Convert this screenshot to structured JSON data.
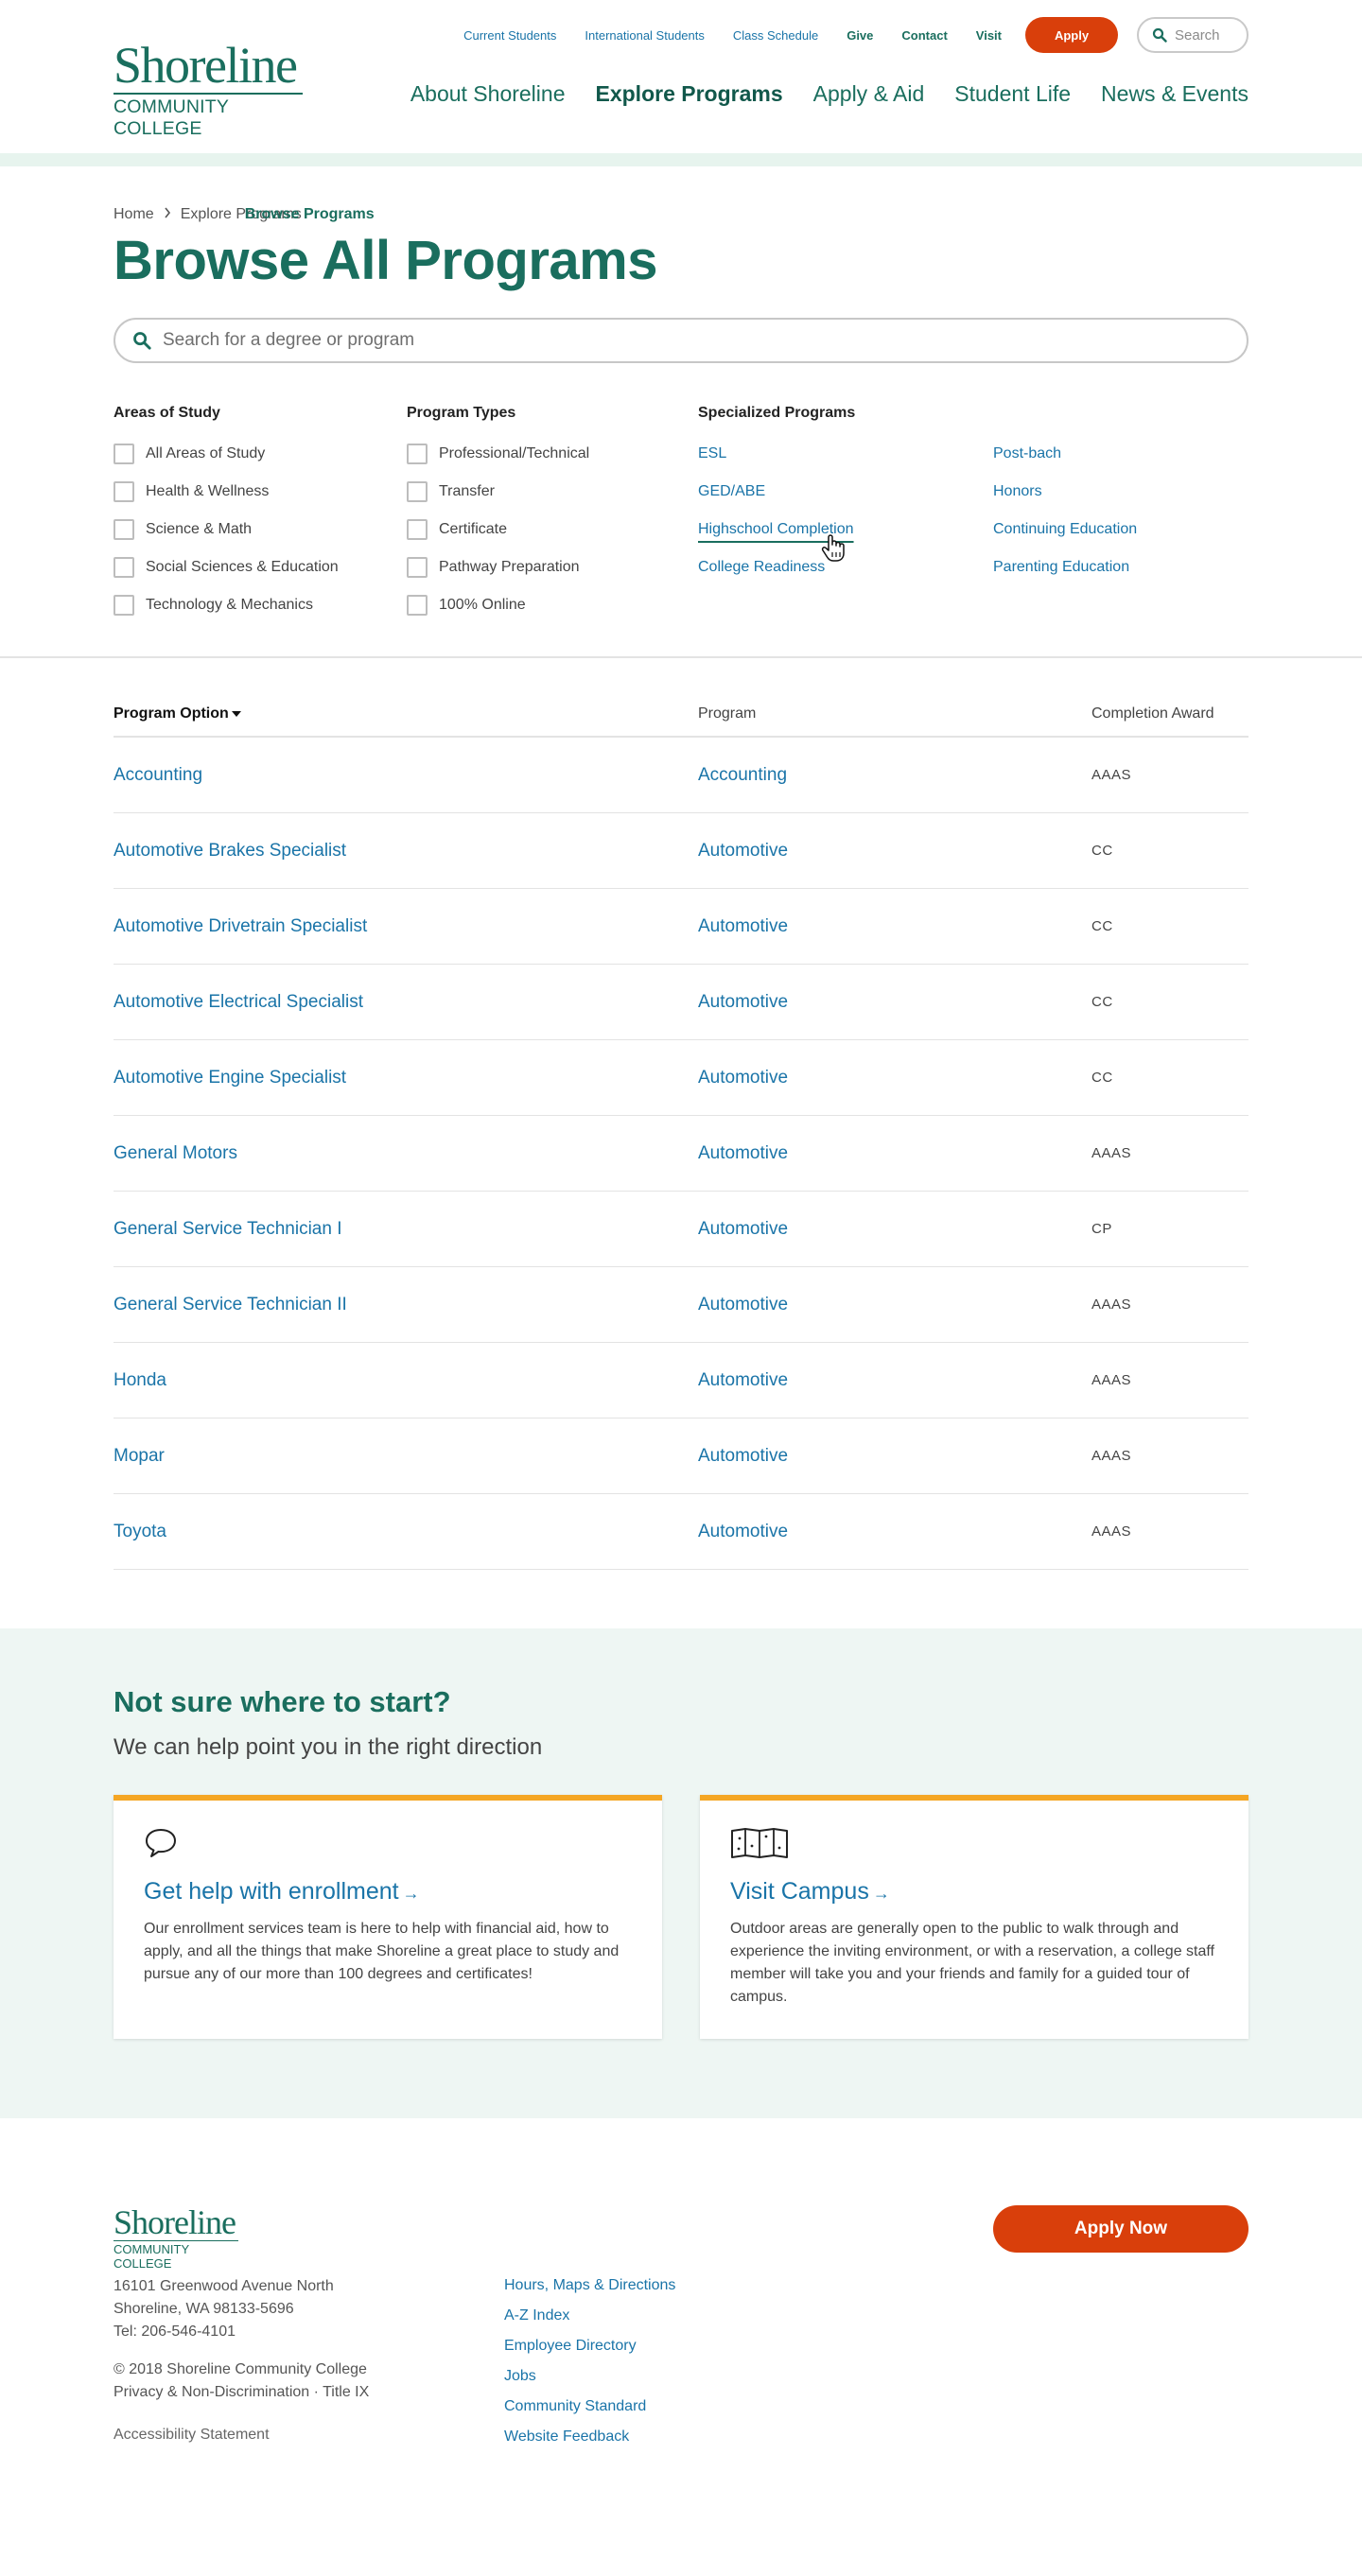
{
  "header": {
    "logo": {
      "name": "Shoreline",
      "sub": "COMMUNITY COLLEGE"
    },
    "util_links": [
      "Current Students",
      "International Students",
      "Class Schedule",
      "Give",
      "Contact",
      "Visit"
    ],
    "apply_label": "Apply",
    "search_placeholder": "Search",
    "main_nav": [
      "About Shoreline",
      "Explore Programs",
      "Apply & Aid",
      "Student Life",
      "News & Events"
    ]
  },
  "breadcrumb": {
    "home": "Home",
    "parent": "Explore Programs",
    "current": "Browse Programs"
  },
  "page_title": "Browse All Programs",
  "search": {
    "placeholder": "Search for a degree or program"
  },
  "filters": {
    "areas": {
      "heading": "Areas of Study",
      "items": [
        "All Areas of Study",
        "Health & Wellness",
        "Science & Math",
        "Social Sciences & Education",
        "Technology & Mechanics"
      ]
    },
    "types": {
      "heading": "Program Types",
      "items": [
        "Professional/Technical",
        "Transfer",
        "Certificate",
        "Pathway Preparation",
        "100% Online"
      ]
    },
    "specialized": {
      "heading": "Specialized Programs",
      "col1": [
        "ESL",
        "GED/ABE",
        "Highschool Completion",
        "College Readiness"
      ],
      "col2": [
        "Post-bach",
        "Honors",
        "Continuing Education",
        "Parenting Education"
      ]
    }
  },
  "table": {
    "headers": [
      "Program Option",
      "Program",
      "Completion Award"
    ],
    "rows": [
      [
        "Accounting",
        "Accounting",
        "AAAS"
      ],
      [
        "Automotive Brakes Specialist",
        "Automotive",
        "CC"
      ],
      [
        "Automotive Drivetrain Specialist",
        "Automotive",
        "CC"
      ],
      [
        "Automotive Electrical Specialist",
        "Automotive",
        "CC"
      ],
      [
        "Automotive Engine Specialist",
        "Automotive",
        "CC"
      ],
      [
        "General Motors",
        "Automotive",
        "AAAS"
      ],
      [
        "General Service Technician I",
        "Automotive",
        "CP"
      ],
      [
        "General Service Technician II",
        "Automotive",
        "AAAS"
      ],
      [
        "Honda",
        "Automotive",
        "AAAS"
      ],
      [
        "Mopar",
        "Automotive",
        "AAAS"
      ],
      [
        "Toyota",
        "Automotive",
        "AAAS"
      ]
    ]
  },
  "help": {
    "title": "Not sure where to start?",
    "subtitle": "We can help point you in the right direction",
    "cards": [
      {
        "icon": "speech-bubble-icon",
        "title": "Get help with enrollment",
        "body": "Our enrollment services team is here to help with financial aid, how to apply, and all the things that make Shoreline a great place to study and pursue any of our more than 100 degrees and certificates!"
      },
      {
        "icon": "map-icon",
        "title": "Visit Campus",
        "body": "Outdoor areas are generally open to the public to walk through and experience the inviting environment, or with a reservation, a college staff member will take you and your friends and family for a guided tour of campus."
      }
    ]
  },
  "footer": {
    "logo": {
      "name": "Shoreline",
      "sub": "COMMUNITY COLLEGE"
    },
    "address": [
      "16101 Greenwood Avenue North",
      "Shoreline, WA 98133-5696",
      "Tel: 206-546-4101"
    ],
    "legal": [
      "© 2018 Shoreline Community College",
      "Privacy & Non-Discrimination · Title IX"
    ],
    "accessibility": "Accessibility Statement",
    "links": [
      "Hours, Maps & Directions",
      "A-Z Index",
      "Employee Directory",
      "Jobs",
      "Community Standard",
      "Website Feedback"
    ],
    "apply_now": "Apply Now"
  },
  "colors": {
    "brand_green": "#1a6e5e",
    "link_blue": "#1a74a8",
    "apply_orange": "#d93f0b",
    "card_accent": "#f5a623",
    "help_bg": "#eef6f3"
  }
}
